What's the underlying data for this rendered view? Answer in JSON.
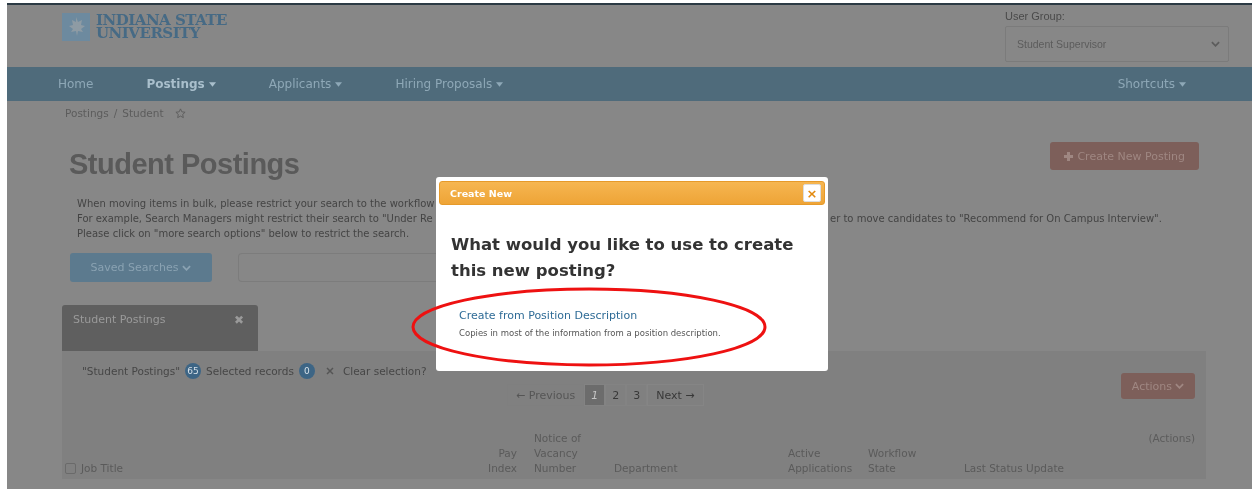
{
  "header": {
    "logo_lines": [
      "INDIANA STATE",
      "UNIVERSITY"
    ],
    "user_group": {
      "label": "User Group:",
      "value": "Student Supervisor"
    }
  },
  "nav": {
    "items": [
      {
        "label": "Home",
        "dropdown": false,
        "selected": false
      },
      {
        "label": "Postings",
        "dropdown": true,
        "selected": true
      },
      {
        "label": "Applicants",
        "dropdown": true,
        "selected": false
      },
      {
        "label": "Hiring Proposals",
        "dropdown": true,
        "selected": false
      }
    ],
    "right_items": [
      {
        "label": "Shortcuts",
        "dropdown": true,
        "selected": false
      }
    ]
  },
  "breadcrumb": [
    "Postings",
    "Student"
  ],
  "breadcrumb_separator": "/",
  "page_title": "Student Postings",
  "create_button": "Create New Posting",
  "description_left": [
    "When moving items in bulk, please restrict your search to the workflow",
    "For example, Search Managers might restrict their search to \"Under Re",
    "Please click on \"more search options\" below to restrict the search."
  ],
  "description_right": "er to move candidates to \"Recommend for On Campus Interview\".",
  "saved_searches_button": "Saved Searches",
  "tab": {
    "label": "Student Postings",
    "close": "✖"
  },
  "records": {
    "list_label": "\"Student Postings\"",
    "list_count": "65",
    "selected_label": "Selected records",
    "selected_count": "0",
    "clear_label": "Clear selection?"
  },
  "actions_button": "Actions",
  "pagination": [
    {
      "label": "← Previous",
      "kind": "prev",
      "selected": false,
      "disabled": true
    },
    {
      "label": "1",
      "kind": "page",
      "selected": true,
      "disabled": false
    },
    {
      "label": "2",
      "kind": "page",
      "selected": false,
      "disabled": false
    },
    {
      "label": "3",
      "kind": "page",
      "selected": false,
      "disabled": false
    },
    {
      "label": "Next →",
      "kind": "next",
      "selected": false,
      "disabled": false
    }
  ],
  "table": {
    "actions_header": "(Actions)",
    "select_all_checked": false,
    "columns": [
      "Job Title",
      "Pay Index",
      "Notice of Vacancy Number",
      "Department",
      "Active Applications",
      "Workflow State",
      "Last Status Update"
    ]
  },
  "modal": {
    "title": "Create New",
    "close": "×",
    "question": "What would you like to use to create this new posting?",
    "options": [
      {
        "link": "Create from Position Description",
        "description": "Copies in most of the information from a position description.",
        "circled": true
      }
    ]
  }
}
